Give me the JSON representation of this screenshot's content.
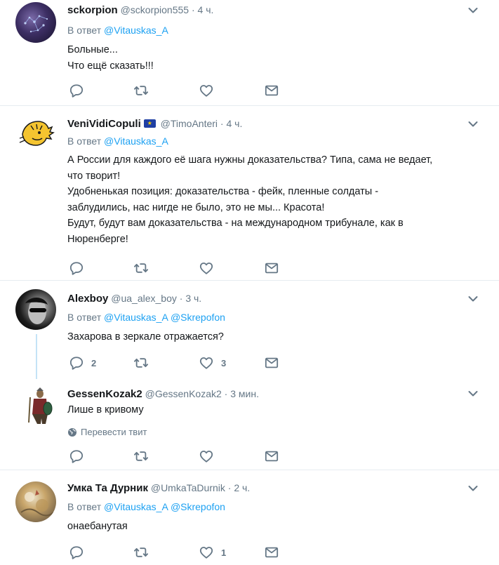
{
  "tweets": [
    {
      "name": "sckorpion",
      "handle": "@sckorpion555",
      "time": "4 ч.",
      "reply_prefix": "В ответ",
      "reply_to": "@Vitauskas_A",
      "text": [
        "Больные...",
        "Что ещё сказать!!!"
      ]
    },
    {
      "name": "VeniVidiCopuli",
      "handle": "@TimoAnteri",
      "time": "4 ч.",
      "reply_prefix": "В ответ",
      "reply_to": "@Vitauskas_A",
      "text": [
        "А России для каждого её шага нужны доказательства? Типа, сама не ведает,",
        "что творит!",
        "Удобненькая позиция: доказательства - фейк, пленные солдаты -",
        "заблудились, нас нигде не было, это не мы... Красота!",
        "Будут, будут вам доказательства - на международном трибунале, как в",
        "Нюренберге!"
      ]
    },
    {
      "name": "Alexboy",
      "handle": "@ua_alex_boy",
      "time": "3 ч.",
      "reply_prefix": "В ответ",
      "reply_to": "@Vitauskas_A",
      "reply_to_2": "@Skrepofon",
      "text": [
        "Захарова в зеркале отражается?"
      ],
      "reply_count": "2",
      "like_count": "3"
    },
    {
      "name": "GessenKozak2",
      "handle": "@GessenKozak2",
      "time": "3 мин.",
      "text": [
        "Лише в кривому"
      ],
      "translate": "Перевести твит"
    },
    {
      "name": "Умка Та Дурник",
      "handle": "@UmkaTaDurnik",
      "time": "2 ч.",
      "reply_prefix": "В ответ",
      "reply_to": "@Vitauskas_A",
      "reply_to_2": "@Skrepofon",
      "text": [
        "онаебанутая"
      ],
      "like_count": "1"
    }
  ],
  "separator": "·",
  "icons": {
    "reply": "reply-icon",
    "retweet": "retweet-icon",
    "like": "heart-icon",
    "dm": "envelope-icon",
    "caret": "chevron-down-icon",
    "globe": "globe-icon"
  },
  "colors": {
    "link": "#1da1f2",
    "muted": "#657786",
    "text": "#14171a",
    "divider": "#e6ecf0"
  }
}
